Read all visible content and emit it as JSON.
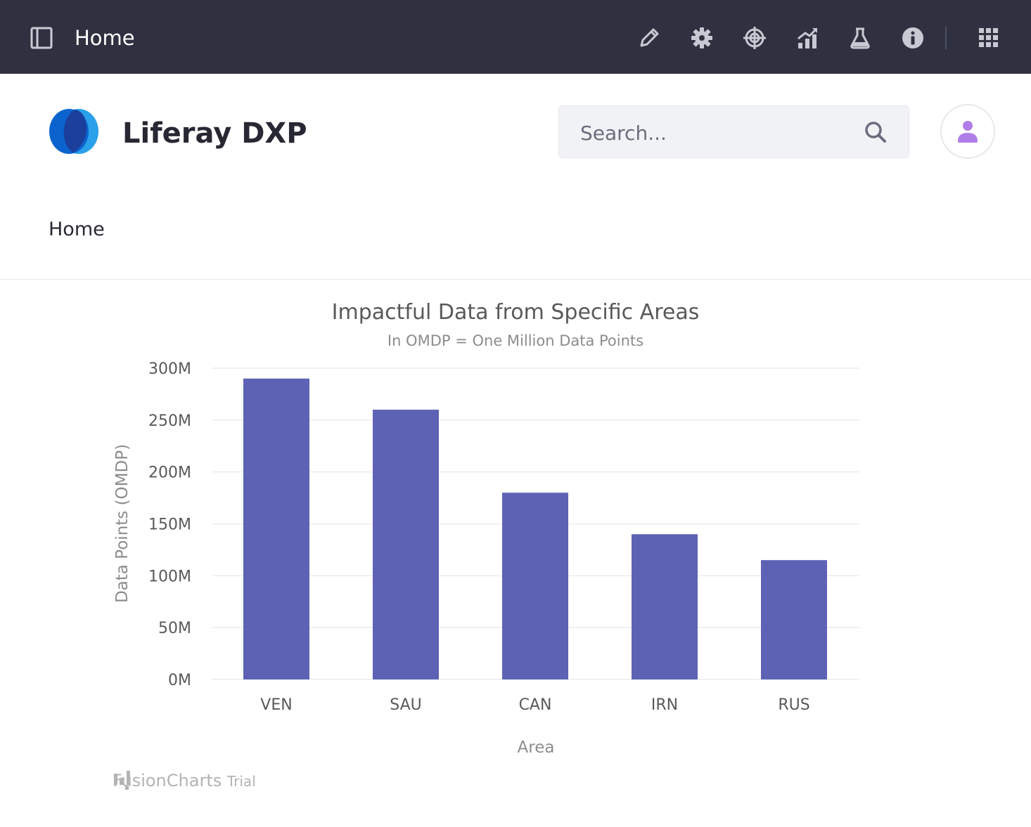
{
  "topbar": {
    "page_name": "Home",
    "icons": [
      "panel-toggle-icon",
      "pencil-icon",
      "gear-icon",
      "target-icon",
      "analytics-icon",
      "flask-icon",
      "info-icon",
      "apps-grid-icon"
    ],
    "background": "#2f3140"
  },
  "header": {
    "site_name": "Liferay DXP",
    "search": {
      "placeholder": "Search..."
    },
    "user_icon_color": "#b07ee8"
  },
  "nav": {
    "home_label": "Home"
  },
  "chart": {
    "watermark_brand": "FusionCharts",
    "watermark_tag": "Trial"
  },
  "chart_data": {
    "type": "bar",
    "title": "Impactful Data from Specific Areas",
    "subtitle": "In OMDP = One Million Data Points",
    "xlabel": "Area",
    "ylabel": "Data Points (OMDP)",
    "categories": [
      "VEN",
      "SAU",
      "CAN",
      "IRN",
      "RUS"
    ],
    "values": [
      290,
      260,
      180,
      140,
      115
    ],
    "ylim": [
      0,
      300
    ],
    "yticks": [
      {
        "value": 0,
        "label": "0M"
      },
      {
        "value": 50,
        "label": "50M"
      },
      {
        "value": 100,
        "label": "100M"
      },
      {
        "value": 150,
        "label": "150M"
      },
      {
        "value": 200,
        "label": "200M"
      },
      {
        "value": 250,
        "label": "250M"
      },
      {
        "value": 300,
        "label": "300M"
      }
    ],
    "bar_color": "#5d62b5",
    "grid": true,
    "legend": "none"
  }
}
